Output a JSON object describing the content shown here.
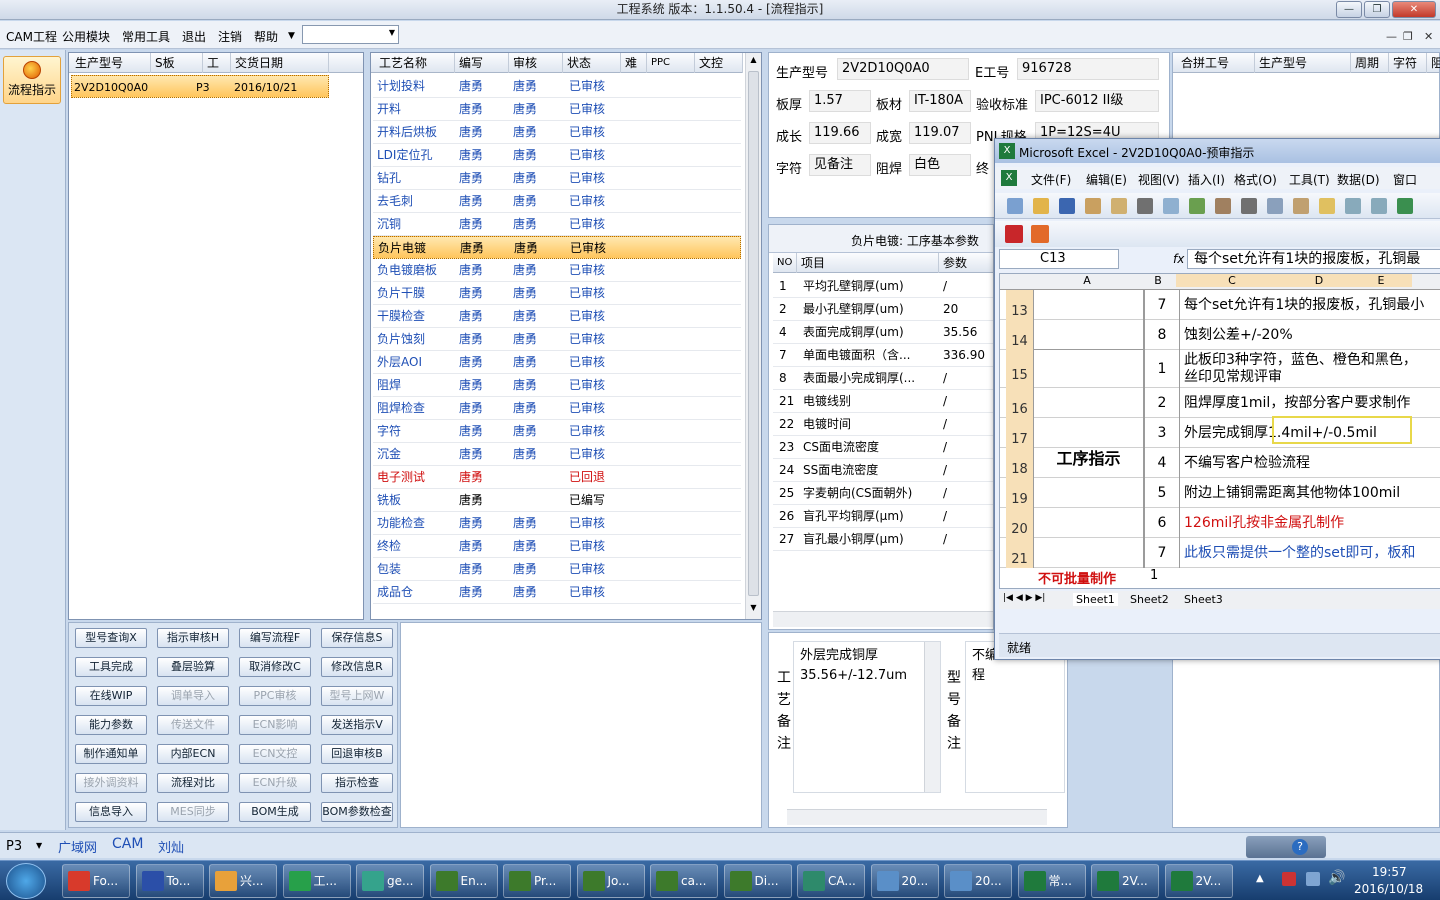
{
  "window": {
    "title": "工程系统  版本：1.1.50.4 - [流程指示]"
  },
  "menu": [
    "CAM工程",
    "公用模块",
    "常用工具",
    "退出",
    "注销",
    "帮助"
  ],
  "left": {
    "flow_button": "流程指示"
  },
  "models": {
    "headers": [
      "生产型号",
      "S板",
      "工厂",
      "交货日期"
    ],
    "rows": [
      [
        "2V2D10Q0A0",
        "",
        "P3",
        "2016/10/21"
      ]
    ]
  },
  "process": {
    "headers": [
      "工艺名称",
      "编写",
      "审核",
      "状态",
      "难",
      "PPC",
      "文控"
    ],
    "rows": [
      {
        "name": "计划投料",
        "writer": "唐勇",
        "reviewer": "唐勇",
        "status": "已审核"
      },
      {
        "name": "开料",
        "writer": "唐勇",
        "reviewer": "唐勇",
        "status": "已审核"
      },
      {
        "name": "开料后烘板",
        "writer": "唐勇",
        "reviewer": "唐勇",
        "status": "已审核"
      },
      {
        "name": "LDI定位孔",
        "writer": "唐勇",
        "reviewer": "唐勇",
        "status": "已审核"
      },
      {
        "name": "钻孔",
        "writer": "唐勇",
        "reviewer": "唐勇",
        "status": "已审核"
      },
      {
        "name": "去毛刺",
        "writer": "唐勇",
        "reviewer": "唐勇",
        "status": "已审核"
      },
      {
        "name": "沉铜",
        "writer": "唐勇",
        "reviewer": "唐勇",
        "status": "已审核"
      },
      {
        "name": "负片电镀",
        "writer": "唐勇",
        "reviewer": "唐勇",
        "status": "已审核"
      },
      {
        "name": "负电镀磨板",
        "writer": "唐勇",
        "reviewer": "唐勇",
        "status": "已审核"
      },
      {
        "name": "负片干膜",
        "writer": "唐勇",
        "reviewer": "唐勇",
        "status": "已审核"
      },
      {
        "name": "干膜检查",
        "writer": "唐勇",
        "reviewer": "唐勇",
        "status": "已审核"
      },
      {
        "name": "负片蚀刻",
        "writer": "唐勇",
        "reviewer": "唐勇",
        "status": "已审核"
      },
      {
        "name": "外层AOI",
        "writer": "唐勇",
        "reviewer": "唐勇",
        "status": "已审核"
      },
      {
        "name": "阻焊",
        "writer": "唐勇",
        "reviewer": "唐勇",
        "status": "已审核"
      },
      {
        "name": "阻焊检查",
        "writer": "唐勇",
        "reviewer": "唐勇",
        "status": "已审核"
      },
      {
        "name": "字符",
        "writer": "唐勇",
        "reviewer": "唐勇",
        "status": "已审核"
      },
      {
        "name": "沉金",
        "writer": "唐勇",
        "reviewer": "唐勇",
        "status": "已审核"
      },
      {
        "name": "电子测试",
        "writer": "唐勇",
        "reviewer": "",
        "status": "已回退"
      },
      {
        "name": "铣板",
        "writer": "唐勇",
        "reviewer": "",
        "status": "已编写"
      },
      {
        "name": "功能检查",
        "writer": "唐勇",
        "reviewer": "唐勇",
        "status": "已审核"
      },
      {
        "name": "终检",
        "writer": "唐勇",
        "reviewer": "唐勇",
        "status": "已审核"
      },
      {
        "name": "包装",
        "writer": "唐勇",
        "reviewer": "唐勇",
        "status": "已审核"
      },
      {
        "name": "成品仓",
        "writer": "唐勇",
        "reviewer": "唐勇",
        "status": "已审核"
      }
    ]
  },
  "buttons": [
    [
      "型号查询X",
      "指示审核H",
      "编写流程F",
      "保存信息S"
    ],
    [
      "工具完成",
      "叠层验算",
      "取消修改C",
      "修改信息R"
    ],
    [
      "在线WIP",
      "调单导入",
      "PPC审核",
      "型号上网W"
    ],
    [
      "能力参数",
      "传送文件",
      "ECN影响",
      "发送指示V"
    ],
    [
      "制作通知单",
      "内部ECN",
      "ECN文控",
      "回退审核B"
    ],
    [
      "接外调资料",
      "流程对比",
      "ECN升级",
      "指示检查"
    ],
    [
      "信息导入",
      "MES同步",
      "BOM生成",
      "BOM参数检查"
    ]
  ],
  "info": {
    "prod_model_label": "生产型号",
    "prod_model": "2V2D10Q0A0",
    "e_label": "E工号",
    "e_value": "916728",
    "thick_label": "板厚",
    "thick": "1.57",
    "mat_label": "板材",
    "mat": "IT-180A",
    "std_label": "验收标准",
    "std": "IPC-6012 II级",
    "len_label": "成长",
    "len": "119.66",
    "wid_label": "成宽",
    "wid": "119.07",
    "pnl_label": "PNL规格",
    "pnl": "1P=12S=4U",
    "char_label": "字符",
    "char": "见备注",
    "mask_label": "阻焊",
    "mask": "白色",
    "third": "终"
  },
  "right_header": [
    "合拼工号",
    "生产型号",
    "周期",
    "字符",
    "阻焊"
  ],
  "params": {
    "title": "负片电镀: 工序基本参数",
    "headers": [
      "NO",
      "项目",
      "参数"
    ],
    "rows": [
      {
        "no": "1",
        "item": "平均孔壁铜厚(um)",
        "val": "/"
      },
      {
        "no": "2",
        "item": "最小孔壁铜厚(um)",
        "val": "20"
      },
      {
        "no": "4",
        "item": "表面完成铜厚(um)",
        "val": "35.56"
      },
      {
        "no": "7",
        "item": "单面电镀面积（含...",
        "val": "336.90"
      },
      {
        "no": "8",
        "item": "表面最小完成铜厚(...",
        "val": "/"
      },
      {
        "no": "21",
        "item": "电镀线别",
        "val": "/"
      },
      {
        "no": "22",
        "item": "电镀时间",
        "val": "/"
      },
      {
        "no": "23",
        "item": "CS面电流密度",
        "val": "/"
      },
      {
        "no": "24",
        "item": "SS面电流密度",
        "val": "/"
      },
      {
        "no": "25",
        "item": "字麦朝向(CS面朝外)",
        "val": "/"
      },
      {
        "no": "26",
        "item": "盲孔平均铜厚(μm)",
        "val": "/"
      },
      {
        "no": "27",
        "item": "盲孔最小铜厚(μm)",
        "val": "/"
      }
    ]
  },
  "remarks": {
    "proc_label": [
      "工",
      "艺",
      "备",
      "注"
    ],
    "proc_text1": "外层完成铜厚",
    "proc_text2": "35.56+/-12.7um",
    "model_label": [
      "型",
      "号",
      "备",
      "注"
    ],
    "model_text1": "不编",
    "model_text2": "程"
  },
  "excel": {
    "title": "Microsoft Excel - 2V2D10Q0A0-预审指示",
    "menus": [
      "文件(F)",
      "编辑(E)",
      "视图(V)",
      "插入(I)",
      "格式(O)",
      "工具(T)",
      "数据(D)",
      "窗口"
    ],
    "cell_ref": "C13",
    "fx": "fx",
    "formula": "每个set允许有1块的报废板，孔铜最",
    "cols": [
      "A",
      "B",
      "C",
      "D",
      "E"
    ],
    "rows": [
      {
        "rn": "13",
        "num": "7",
        "text": "每个set允许有1块的报废板，孔铜最小",
        "red": false
      },
      {
        "rn": "14",
        "num": "8",
        "text": "蚀刻公差+/-20%",
        "red": false
      },
      {
        "rn": "15",
        "num": "1",
        "text": "此板印3种字符，蓝色、橙色和黑色，",
        "text2": "丝印见常规评审",
        "red": false
      },
      {
        "rn": "16",
        "num": "2",
        "text": "阻焊厚度1mil，按部分客户要求制作",
        "red": false
      },
      {
        "rn": "17",
        "num": "3",
        "text": "外层完成铜厚1.4mil+/-0.5mil",
        "red": false
      },
      {
        "rn": "18",
        "num": "4",
        "text": "不编写客户检验流程",
        "red": false
      },
      {
        "rn": "19",
        "num": "5",
        "text": "附边上铺铜需距离其他物体100mil",
        "red": false
      },
      {
        "rn": "20",
        "num": "6",
        "text": "126mil孔按非金属孔制作",
        "red": true
      },
      {
        "rn": "21",
        "num": "7",
        "text": "此板只需提供一个整的set即可，板和",
        "red": false,
        "blue": true
      }
    ],
    "merged_label": "工序指示",
    "next_label": "不可批量制作",
    "next_num": "1",
    "sheets": [
      "Sheet1",
      "Sheet2",
      "Sheet3"
    ],
    "status": "就绪"
  },
  "statusbar": {
    "factory": "P3",
    "tabs": [
      "广域网",
      "CAM",
      "刘灿"
    ]
  },
  "taskbar": {
    "items": [
      {
        "label": "Fo...",
        "color": "#d83a2b"
      },
      {
        "label": "To...",
        "color": "#2b4fa8"
      },
      {
        "label": "兴...",
        "color": "#e8a13a"
      },
      {
        "label": "工...",
        "color": "#27a04a"
      },
      {
        "label": "ge...",
        "color": "#35a38c"
      },
      {
        "label": "En...",
        "color": "#3d7a2b"
      },
      {
        "label": "Pr...",
        "color": "#3d7a2b"
      },
      {
        "label": "Jo...",
        "color": "#3d7a2b"
      },
      {
        "label": "ca...",
        "color": "#3d7a2b"
      },
      {
        "label": "Di...",
        "color": "#3d7a2b"
      },
      {
        "label": "CA...",
        "color": "#2e8a6b"
      },
      {
        "label": "20...",
        "color": "#5a8fc8"
      },
      {
        "label": "20...",
        "color": "#5a8fc8"
      },
      {
        "label": "常...",
        "color": "#1f7a3c"
      },
      {
        "label": "2V...",
        "color": "#1f7a3c"
      },
      {
        "label": "2V...",
        "color": "#1f7a3c"
      }
    ],
    "time": "19:57",
    "date": "2016/10/18"
  }
}
